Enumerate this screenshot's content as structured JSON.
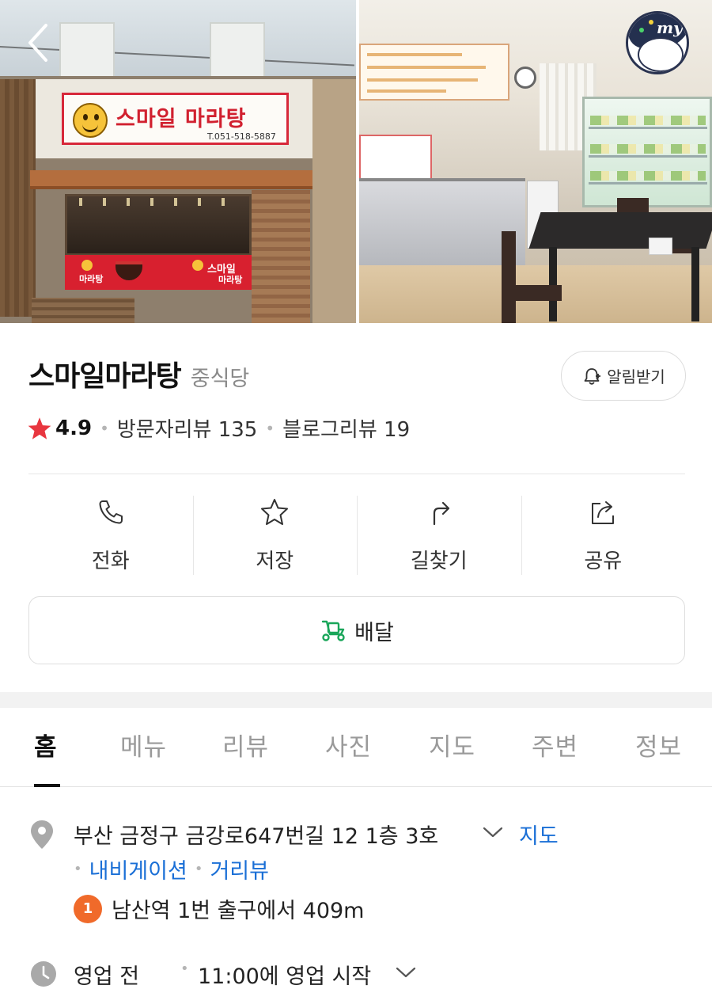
{
  "photos": {
    "left": {
      "sign_text": "스마일 마라탕",
      "sign_phone": "T.051-518-5887",
      "banner_left": "마라탕",
      "banner_right": "스마일",
      "banner_right2": "마라탕"
    },
    "right": {}
  },
  "header": {
    "avatar_label": "my"
  },
  "place": {
    "name": "스마일마라탕",
    "category": "중식당",
    "alarm_label": "알림받기",
    "rating": "4.9",
    "visitor_reviews": "방문자리뷰 135",
    "blog_reviews": "블로그리뷰 19"
  },
  "actions": [
    {
      "label": "전화",
      "icon": "phone-icon"
    },
    {
      "label": "저장",
      "icon": "star-icon"
    },
    {
      "label": "길찾기",
      "icon": "directions-icon"
    },
    {
      "label": "공유",
      "icon": "share-icon"
    }
  ],
  "delivery": {
    "label": "배달",
    "icon": "delivery-scooter-icon",
    "icon_color": "#1aa65a"
  },
  "tabs": [
    "홈",
    "메뉴",
    "리뷰",
    "사진",
    "지도",
    "주변",
    "정보"
  ],
  "active_tab": "홈",
  "details": {
    "address": "부산 금정구 금강로647번길 12 1층 3호",
    "map_link": "지도",
    "navigation_link": "내비게이션",
    "street_view_link": "거리뷰",
    "subway_line": "1",
    "subway_text": "남산역 1번 출구에서 409m",
    "hours_state": "영업 전",
    "hours_text": "11:00에 영업 시작"
  },
  "colors": {
    "link": "#1a6fd6",
    "star": "#e8363f",
    "subway_line_1": "#f06a2a"
  }
}
